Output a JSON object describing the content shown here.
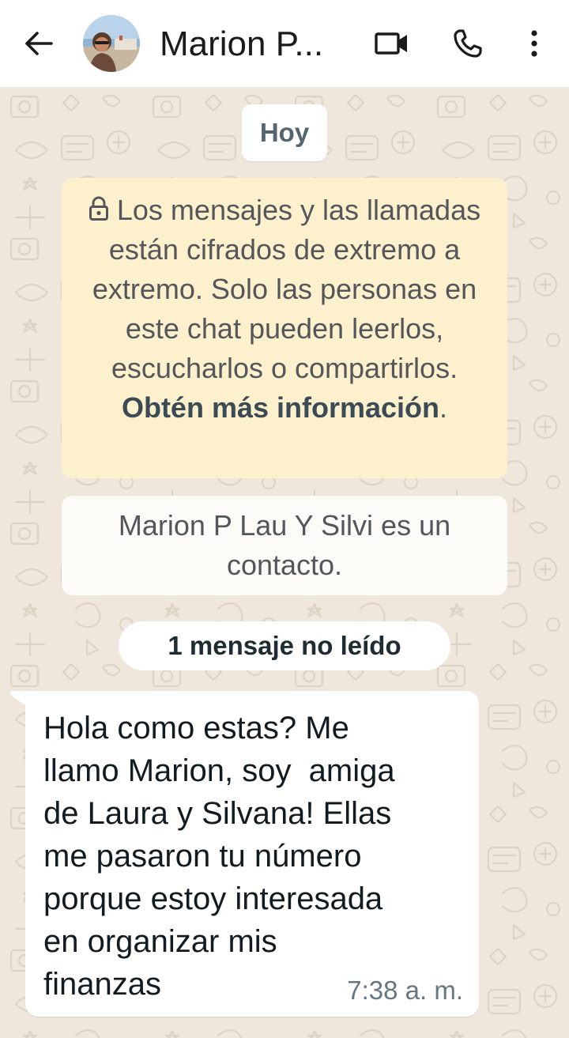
{
  "header": {
    "contact_name": "Marion P...",
    "avatar_label": "Marion P Lau Y Silvi"
  },
  "icons": {
    "back": "arrow-back-icon",
    "video": "video-call-icon",
    "call": "phone-call-icon",
    "menu": "more-vertical-icon",
    "lock": "lock-icon"
  },
  "chat": {
    "date_label": "Hoy",
    "encryption_text": "Los mensajes y las llamadas están cifrados de extremo a extremo. Solo las personas en este chat pueden leerlos, escucharlos o compartirlos. ",
    "encryption_link": "Obtén más información",
    "encryption_period": ".",
    "contact_notice": "Marion P Lau Y Silvi es un contacto.",
    "unread_label": "1 mensaje no leído"
  },
  "messages": [
    {
      "text": "Hola como estas? Me\nllamo Marion, soy  amiga\nde Laura y Silvana! Ellas\nme pasaron tu número\nporque estoy interesada\nen organizar mis\nfinanzas",
      "time": "7:38 a. m."
    }
  ],
  "colors": {
    "header_bg": "#ffffff",
    "chat_bg": "#efe7dc",
    "encryption_bg": "#fdf0cc",
    "bubble_bg": "#ffffff",
    "time_text": "#667781"
  }
}
